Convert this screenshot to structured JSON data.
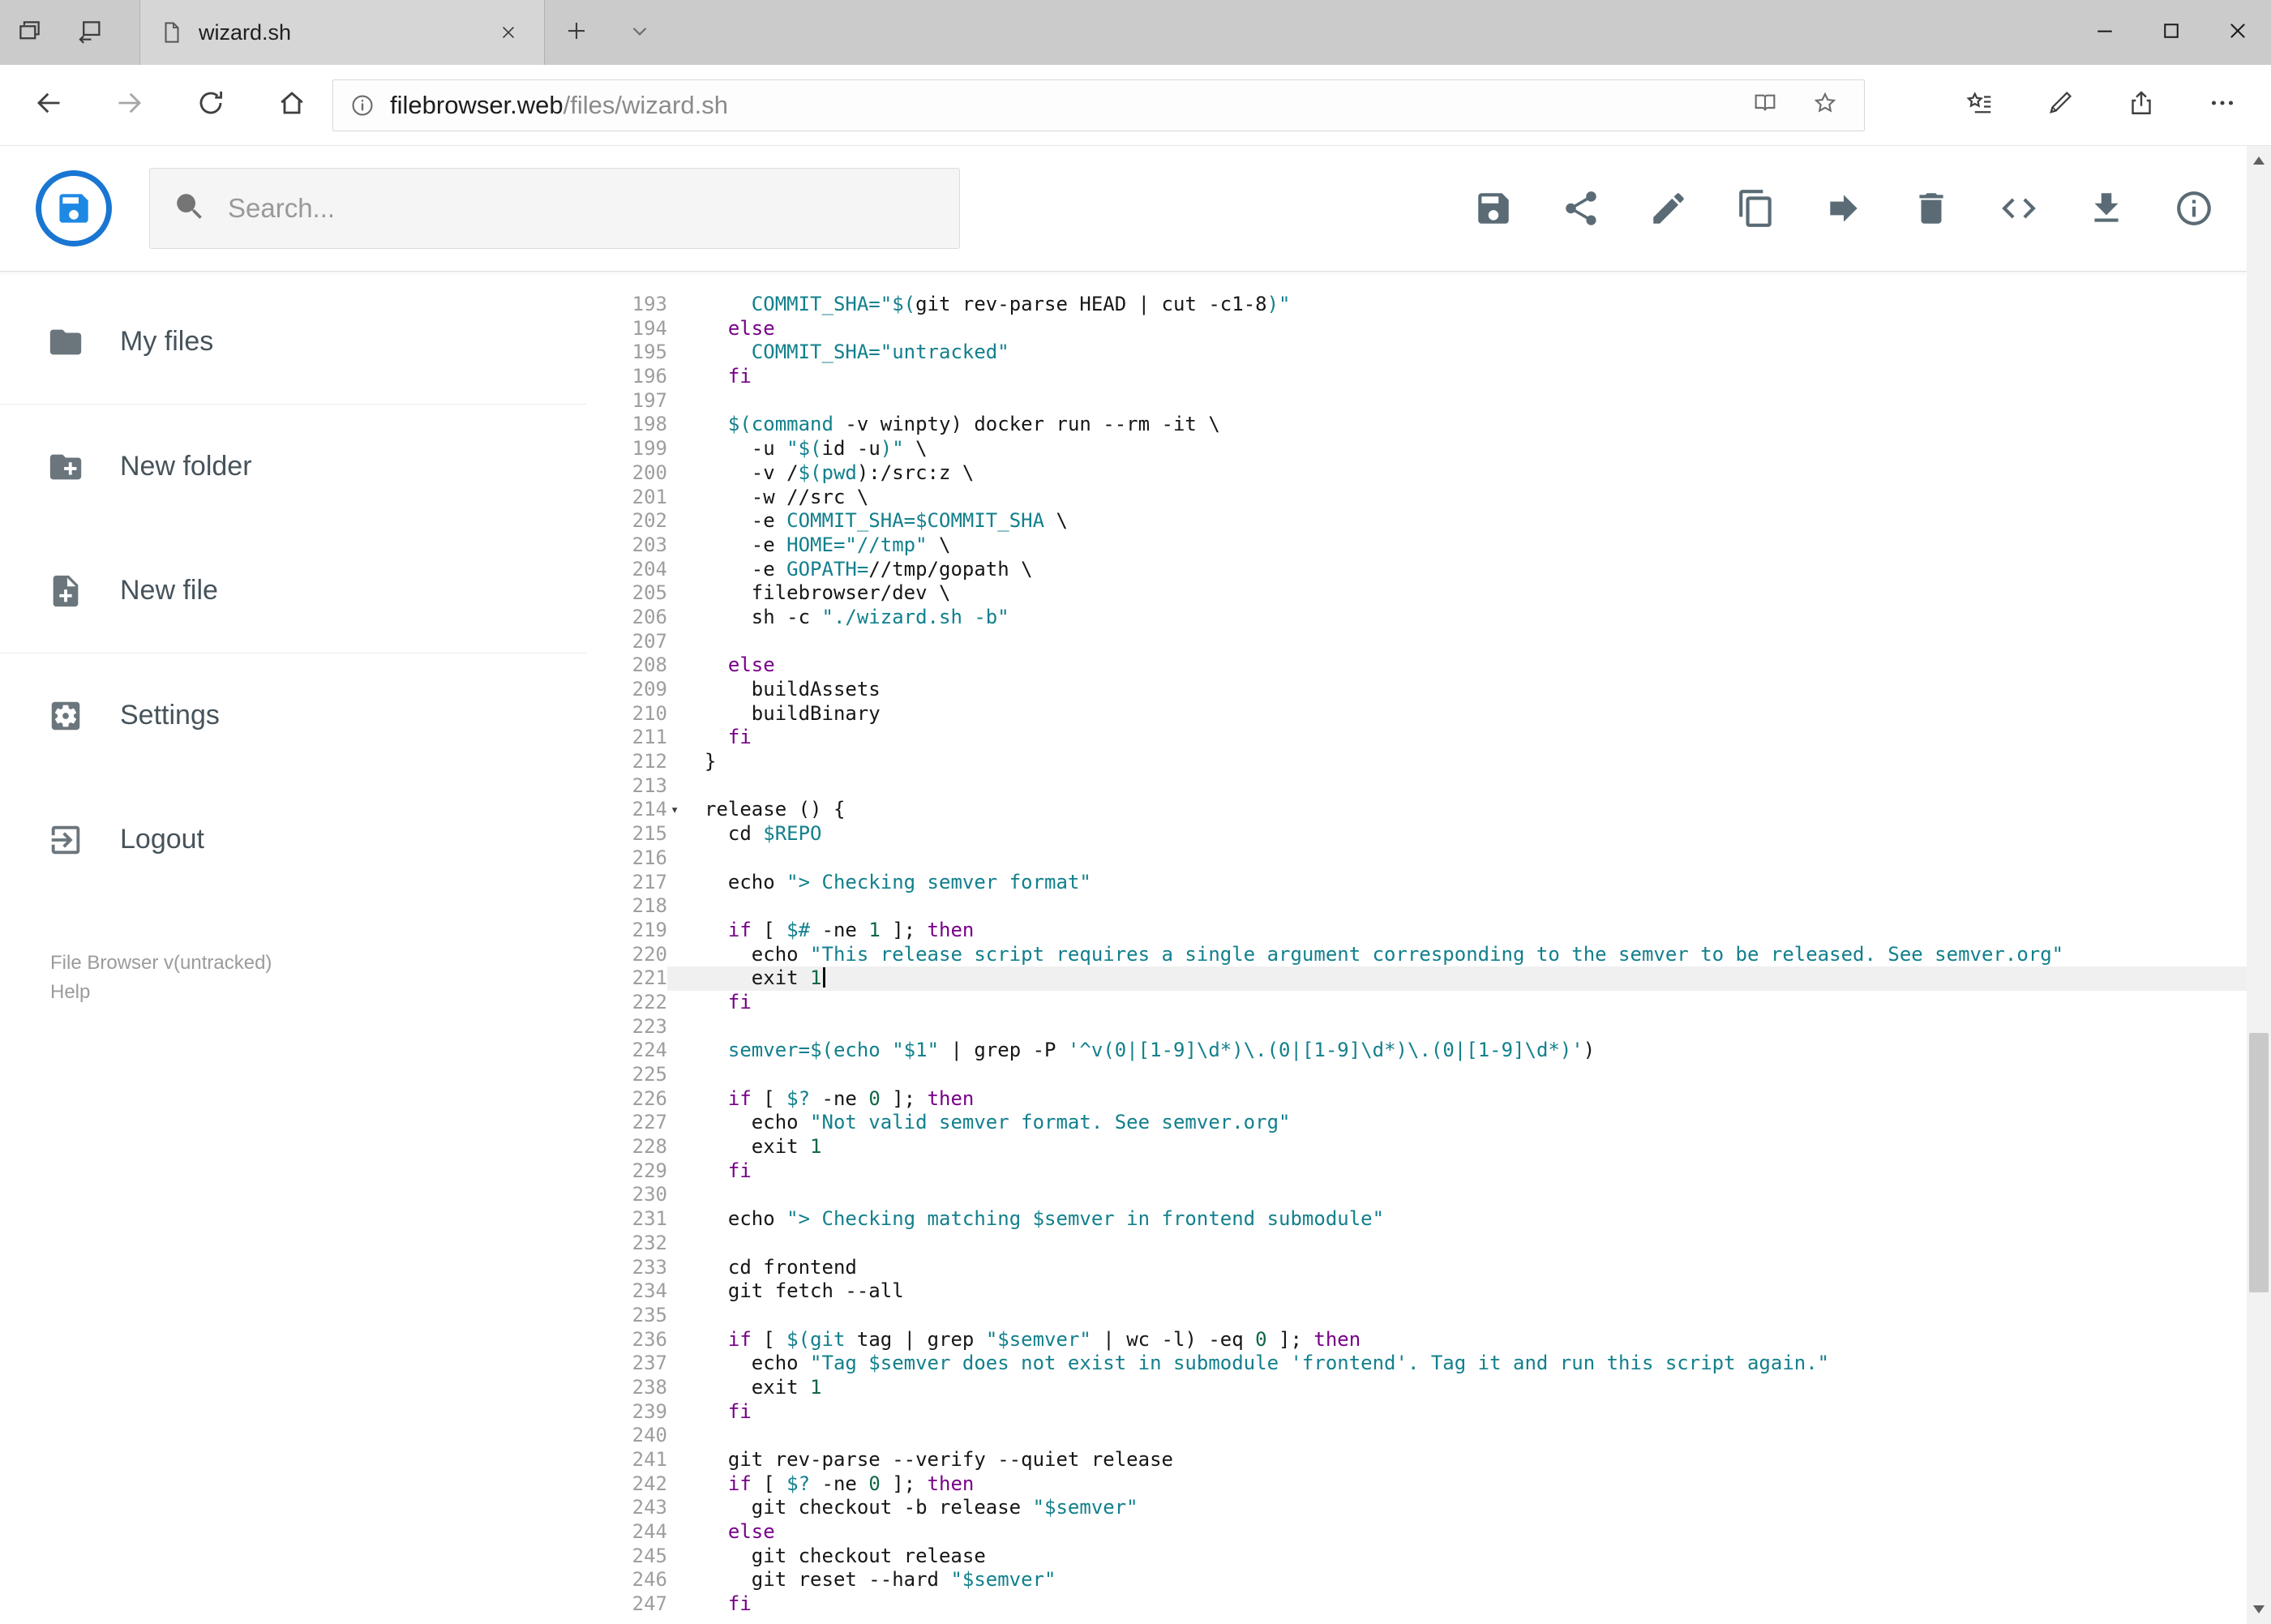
{
  "window": {
    "tab_title": "wizard.sh",
    "controls": [
      "minimize",
      "maximize",
      "close"
    ]
  },
  "browser": {
    "url_host": "filebrowser.web",
    "url_path": "/files/wizard.sh",
    "nav_icons": [
      "back",
      "forward",
      "refresh",
      "home"
    ],
    "address_icons": [
      "page-info",
      "reading-view",
      "favorite-star"
    ],
    "right_icons": [
      "hub",
      "web-note",
      "share",
      "more"
    ]
  },
  "app": {
    "search_placeholder": "Search...",
    "toolbar_icons": [
      "save",
      "share",
      "rename",
      "copy",
      "move",
      "delete",
      "code",
      "download",
      "info"
    ],
    "sidebar": [
      {
        "label": "My files",
        "icon": "folder"
      },
      {
        "label": "New folder",
        "icon": "create-new-folder"
      },
      {
        "label": "New file",
        "icon": "note-add"
      },
      {
        "label": "Settings",
        "icon": "settings"
      },
      {
        "label": "Logout",
        "icon": "exit-to-app"
      }
    ],
    "footer_version": "File Browser v(untracked)",
    "footer_help": "Help"
  },
  "editor": {
    "language": "shell",
    "first_line_number": 193,
    "active_line_number": 221,
    "fold_marker_line": 214,
    "lines": [
      "    COMMIT_SHA=\"$(git rev-parse HEAD | cut -c1-8)\"",
      "  else",
      "    COMMIT_SHA=\"untracked\"",
      "  fi",
      "",
      "  $(command -v winpty) docker run --rm -it \\",
      "    -u \"$(id -u)\" \\",
      "    -v /$(pwd):/src:z \\",
      "    -w //src \\",
      "    -e COMMIT_SHA=$COMMIT_SHA \\",
      "    -e HOME=\"//tmp\" \\",
      "    -e GOPATH=//tmp/gopath \\",
      "    filebrowser/dev \\",
      "    sh -c \"./wizard.sh -b\"",
      "",
      "  else",
      "    buildAssets",
      "    buildBinary",
      "  fi",
      "}",
      "",
      "release () {",
      "  cd $REPO",
      "",
      "  echo \"> Checking semver format\"",
      "",
      "  if [ $# -ne 1 ]; then",
      "    echo \"This release script requires a single argument corresponding to the semver to be released. See semver.org\"",
      "    exit 1",
      "  fi",
      "",
      "  semver=$(echo \"$1\" | grep -P '^v(0|[1-9]\\d*)\\.(0|[1-9]\\d*)\\.(0|[1-9]\\d*)')",
      "",
      "  if [ $? -ne 0 ]; then",
      "    echo \"Not valid semver format. See semver.org\"",
      "    exit 1",
      "  fi",
      "",
      "  echo \"> Checking matching $semver in frontend submodule\"",
      "",
      "  cd frontend",
      "  git fetch --all",
      "",
      "  if [ $(git tag | grep \"$semver\" | wc -l) -eq 0 ]; then",
      "    echo \"Tag $semver does not exist in submodule 'frontend'. Tag it and run this script again.\"",
      "    exit 1",
      "  fi",
      "",
      "  git rev-parse --verify --quiet release",
      "  if [ $? -ne 0 ]; then",
      "    git checkout -b release \"$semver\"",
      "  else",
      "    git checkout release",
      "    git reset --hard \"$semver\"",
      "  fi"
    ]
  },
  "colors": {
    "accent": "#1e88e5",
    "keyword": "#770088",
    "string": "#12808c",
    "variable": "#12808c",
    "number": "#116644"
  }
}
